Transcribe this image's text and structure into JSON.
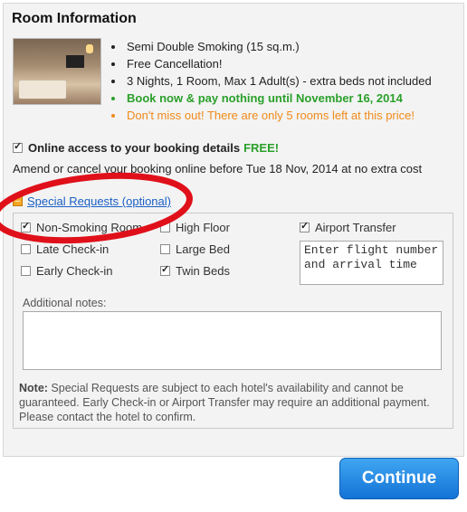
{
  "room": {
    "title": "Room Information",
    "details": [
      "Semi Double Smoking (15 sq.m.)",
      "Free Cancellation!",
      "3 Nights, 1 Room, Max 1 Adult(s) - extra beds not included",
      "Book now & pay nothing until November 16, 2014",
      "Don't miss out! There are only 5 rooms left at this price!"
    ]
  },
  "online": {
    "label": "Online access to your booking details",
    "free": "FREE!",
    "checked": true,
    "amend_text": "Amend or cancel your booking online before Tue 18 Nov, 2014 at no extra cost"
  },
  "special_requests": {
    "toggle_label": "Special Requests (optional)",
    "options": [
      {
        "label": "Non-Smoking Room",
        "checked": true
      },
      {
        "label": "High Floor",
        "checked": false
      },
      {
        "label": "Airport Transfer",
        "checked": true
      },
      {
        "label": "Late Check-in",
        "checked": false
      },
      {
        "label": "Large Bed",
        "checked": false
      },
      {
        "label": "Early Check-in",
        "checked": false
      },
      {
        "label": "Twin Beds",
        "checked": true
      }
    ],
    "flight_placeholder": "Enter flight number and arrival time",
    "notes_label": "Additional notes:",
    "note_bold": "Note:",
    "note_text": " Special Requests are subject to each hotel's availability and cannot be guaranteed. Early Check-in or Airport Transfer may require an additional payment. Please contact the hotel to confirm."
  },
  "continue_label": "Continue",
  "colors": {
    "accent_green": "#2aa02a",
    "accent_orange": "#f08a1a",
    "link_blue": "#1a5fc4",
    "button_blue": "#1a7ee0",
    "highlight_red": "#e0101a"
  }
}
